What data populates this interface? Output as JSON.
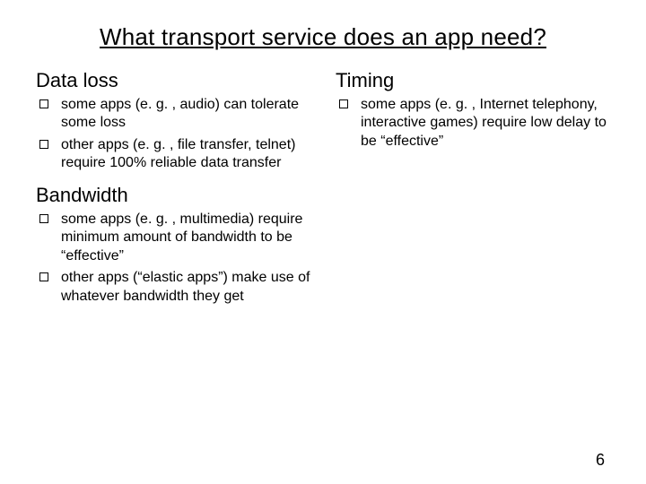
{
  "title": "What transport service does an app need?",
  "left": {
    "sections": [
      {
        "heading": "Data loss",
        "items": [
          "some apps (e. g. , audio) can tolerate some loss",
          "other apps (e. g. , file transfer, telnet) require 100% reliable data transfer"
        ]
      },
      {
        "heading": "Bandwidth",
        "items": [
          "some apps (e. g. , multimedia) require minimum amount of bandwidth to be “effective”",
          "other apps (“elastic apps”) make use of whatever bandwidth they get"
        ]
      }
    ]
  },
  "right": {
    "sections": [
      {
        "heading": "Timing",
        "items": [
          "some apps (e. g. , Internet telephony, interactive games) require low delay to be “effective”"
        ]
      }
    ]
  },
  "page": "6"
}
